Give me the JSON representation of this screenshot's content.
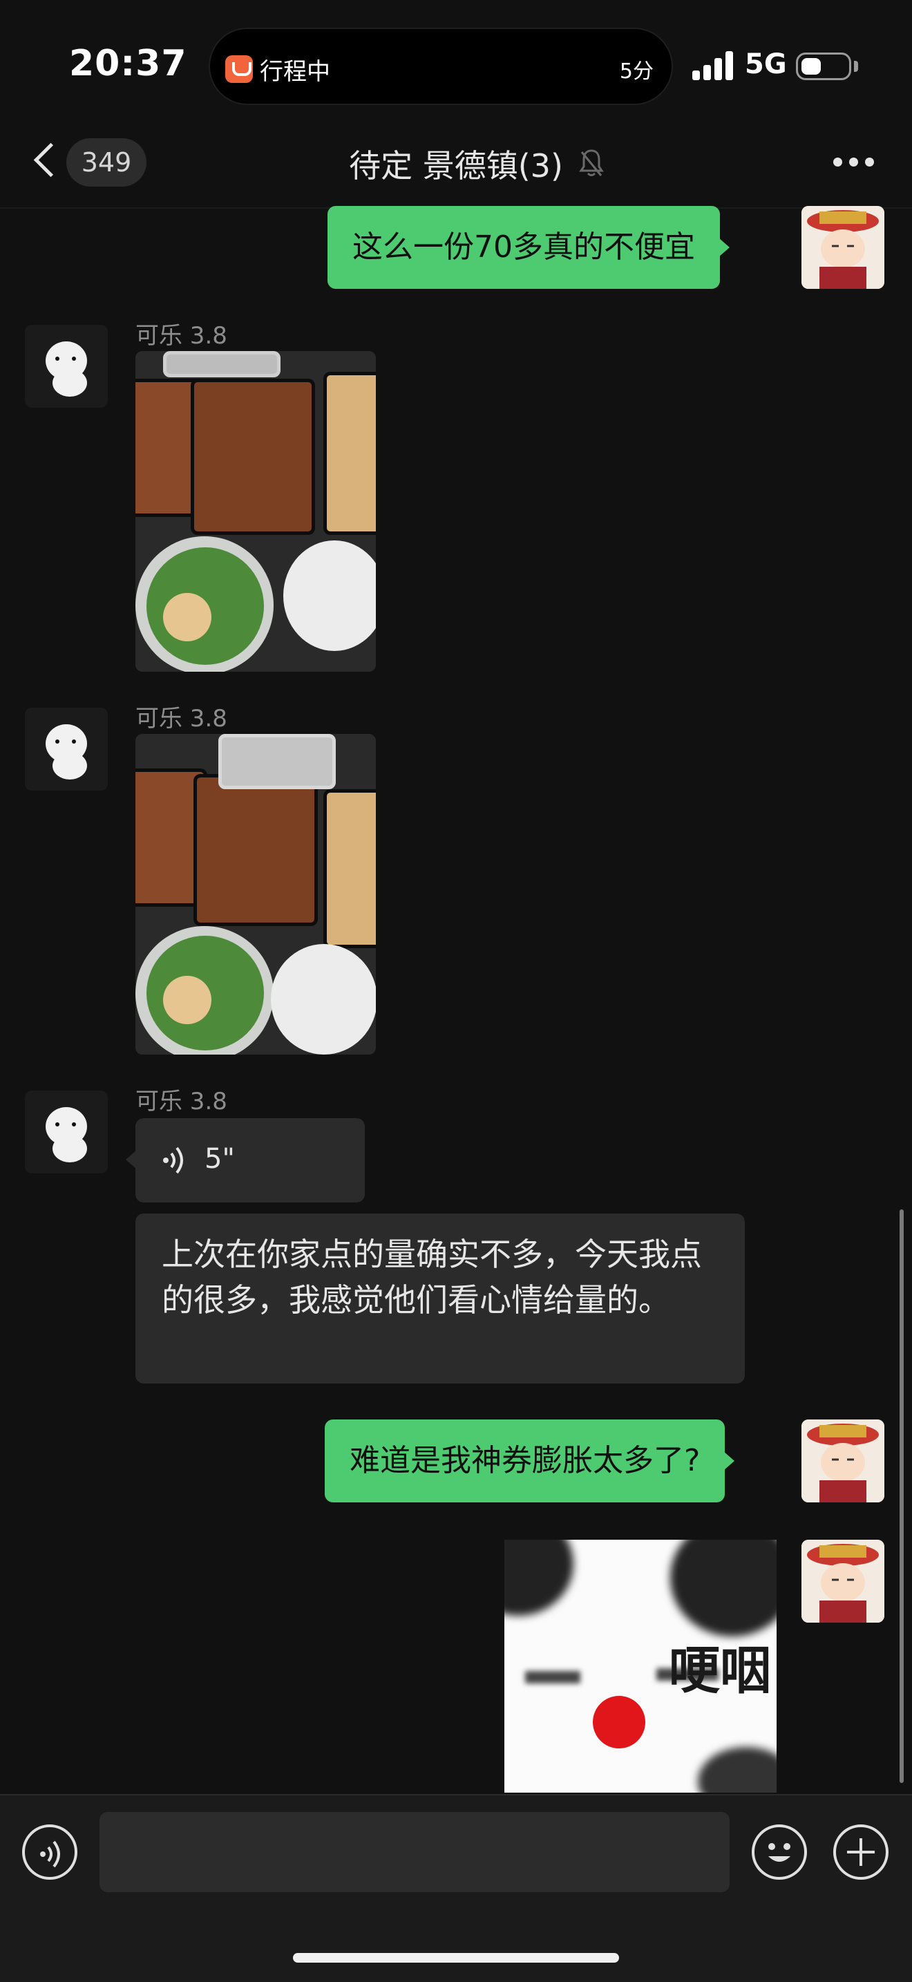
{
  "status_bar": {
    "time": "20:37",
    "live_activity_label": "行程中",
    "live_activity_eta": "5分",
    "network": "5G",
    "icons": [
      "ride-hailing-icon",
      "signal-icon",
      "battery-icon"
    ]
  },
  "nav": {
    "unread_count": "349",
    "title": "待定 景德镇(3)",
    "icons": [
      "back-icon",
      "mute-bell-icon",
      "more-icon"
    ]
  },
  "messages": [
    {
      "type": "text",
      "from": "self",
      "text": "这么一份70多真的不便宜"
    },
    {
      "type": "image",
      "from": "other",
      "sender": "可乐 3.8",
      "description": "food-photo"
    },
    {
      "type": "image",
      "from": "other",
      "sender": "可乐 3.8",
      "description": "food-photo"
    },
    {
      "type": "voice",
      "from": "other",
      "sender": "可乐 3.8",
      "duration": "5\""
    },
    {
      "type": "text",
      "from": "other",
      "text": "上次在你家点的量确实不多，今天我点的很多，我感觉他们看心情给量的。"
    },
    {
      "type": "text",
      "from": "self",
      "text": "难道是我神券膨胀太多了?"
    },
    {
      "type": "sticker",
      "from": "self",
      "text": "哽咽"
    }
  ],
  "input_bar": {
    "placeholder": "",
    "icons": [
      "voice-input-icon",
      "emoji-icon",
      "plus-icon"
    ]
  },
  "colors": {
    "background": "#111111",
    "self_bubble": "#4ecb71",
    "other_bubble": "#2b2b2b"
  }
}
